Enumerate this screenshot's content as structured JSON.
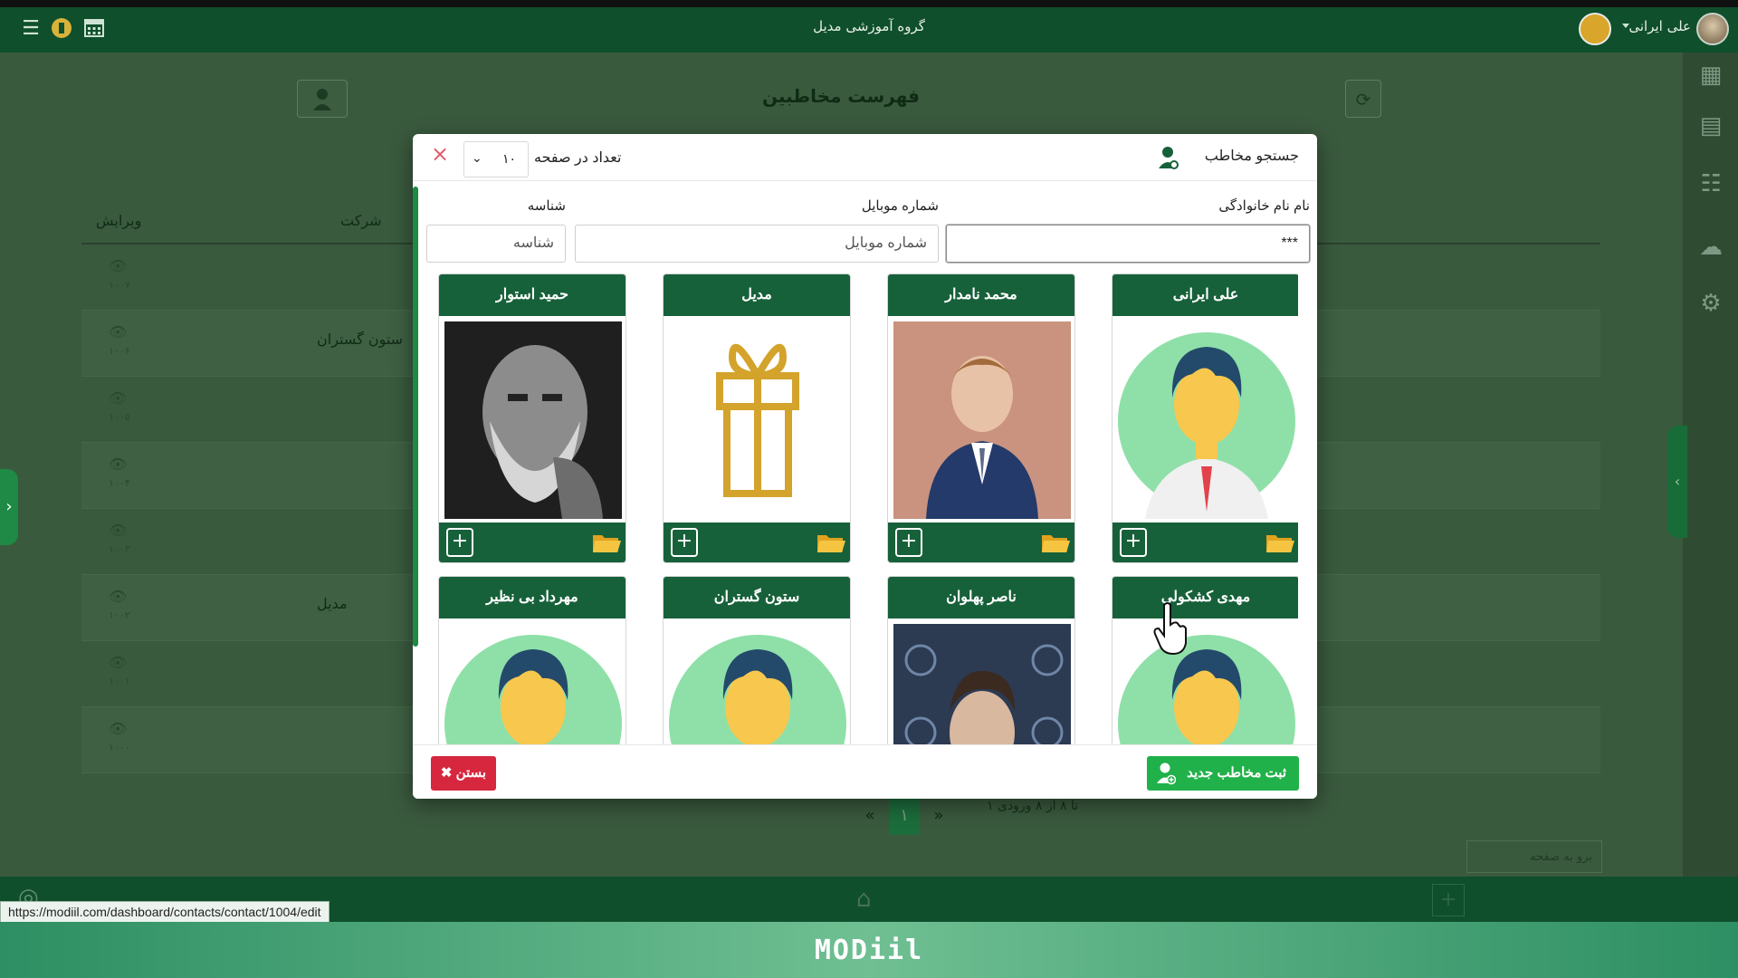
{
  "topbar": {
    "title": "گروه آموزشی مدیل",
    "user_name": "علی ایرانی",
    "icons": [
      "list-icon",
      "coin-icon",
      "calendar-icon"
    ]
  },
  "background_page": {
    "title": "فهرست مخاطبین",
    "columns": {
      "edit": "ویرایش",
      "company": "شرکت"
    },
    "rows": [
      {
        "id": "۱۰۰۷",
        "company": ""
      },
      {
        "id": "۱۰۰۶",
        "company": "ستون گستران"
      },
      {
        "id": "۱۰۰۵",
        "company": ""
      },
      {
        "id": "۱۰۰۴",
        "company": ""
      },
      {
        "id": "۱۰۰۳",
        "company": ""
      },
      {
        "id": "۱۰۰۲",
        "company": "مدیل"
      },
      {
        "id": "۱۰۰۱",
        "company": ""
      },
      {
        "id": "۱۰۰۰",
        "company": ""
      }
    ],
    "pager": {
      "current": "۱",
      "info": "۱ تا ۸ از ۸ ورودی"
    },
    "goto_page_placeholder": "برو به صفحه"
  },
  "modal": {
    "title": "جستجو مخاطب",
    "per_page_label": "تعداد در صفحه",
    "per_page_value": "۱۰",
    "close_symbol": "×",
    "fields": {
      "name": {
        "label": "نام نام خانوادگی",
        "value": "***"
      },
      "mobile": {
        "label": "شماره موبایل",
        "placeholder": "شماره موبایل"
      },
      "id": {
        "label": "شناسه",
        "placeholder": "شناسه"
      }
    },
    "contacts": [
      {
        "name": "علی ایرانی",
        "photo": "default-avatar"
      },
      {
        "name": "محمد نامدار",
        "photo": "boy-portrait"
      },
      {
        "name": "مدیل",
        "photo": "gift-box"
      },
      {
        "name": "حمید استوار",
        "photo": "old-man-bw"
      },
      {
        "name": "مهدی کشکولی",
        "photo": "default-avatar"
      },
      {
        "name": "ناصر پهلوان",
        "photo": "man-portrait"
      },
      {
        "name": "ستون گستران",
        "photo": "default-avatar"
      },
      {
        "name": "مهرداد بی نظیر",
        "photo": "default-avatar"
      }
    ],
    "buttons": {
      "new_contact": "ثبت مخاطب جدید",
      "close": "بستن"
    }
  },
  "status_url": "https://modiil.com/dashboard/contacts/contact/1004/edit",
  "footer_logo": "MODiil",
  "colors": {
    "brand_green": "#17613a",
    "accent_green": "#21b14a",
    "danger_red": "#d6273f"
  }
}
